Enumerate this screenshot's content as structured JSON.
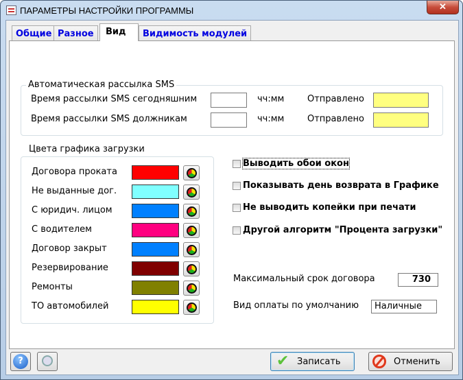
{
  "window": {
    "title": "ПАРАМЕТРЫ НАСТРОЙКИ ПРОГРАММЫ",
    "close": "✕"
  },
  "tabs": [
    {
      "label": "Общие"
    },
    {
      "label": "Разное"
    },
    {
      "label": "Вид"
    },
    {
      "label": "Видимость модулей"
    }
  ],
  "sms": {
    "title": "Автоматическая рассылка SMS",
    "rows": [
      {
        "label": "Время рассылки SMS сегодняшним",
        "value": "",
        "unit": "чч:мм",
        "sent_label": "Отправлено",
        "sent_value": ""
      },
      {
        "label": "Время рассылки SMS должникам",
        "value": "",
        "unit": "чч:мм",
        "sent_label": "Отправлено",
        "sent_value": ""
      }
    ],
    "sent_color": "#ffff80"
  },
  "colors": {
    "title": "Цвета графика загрузки",
    "items": [
      {
        "label": "Договора проката",
        "color": "#ff0000"
      },
      {
        "label": "Не выданные дог.",
        "color": "#80ffff"
      },
      {
        "label": "С юридич. лицом",
        "color": "#0080ff"
      },
      {
        "label": "С водителем",
        "color": "#ff0080"
      },
      {
        "label": "Договор закрыт",
        "color": "#0080ff"
      },
      {
        "label": "Резервирование",
        "color": "#800000"
      },
      {
        "label": "Ремонты",
        "color": "#808000"
      },
      {
        "label": "ТО автомобилей",
        "color": "#ffff00"
      }
    ]
  },
  "options": [
    {
      "label": "Выводить обои окон",
      "checked": false
    },
    {
      "label": "Показывать день возврата в Графике",
      "checked": false
    },
    {
      "label": "Не выводить копейки при печати",
      "checked": false
    },
    {
      "label": "Другой алгоритм \"Процента загрузки\"",
      "checked": false
    }
  ],
  "max_term": {
    "label": "Максимальный срок договора",
    "value": "730"
  },
  "payment": {
    "label": "Вид оплаты по умолчанию",
    "value": "Наличные"
  },
  "buttons": {
    "save": "Записать",
    "cancel": "Отменить",
    "help": "?"
  }
}
